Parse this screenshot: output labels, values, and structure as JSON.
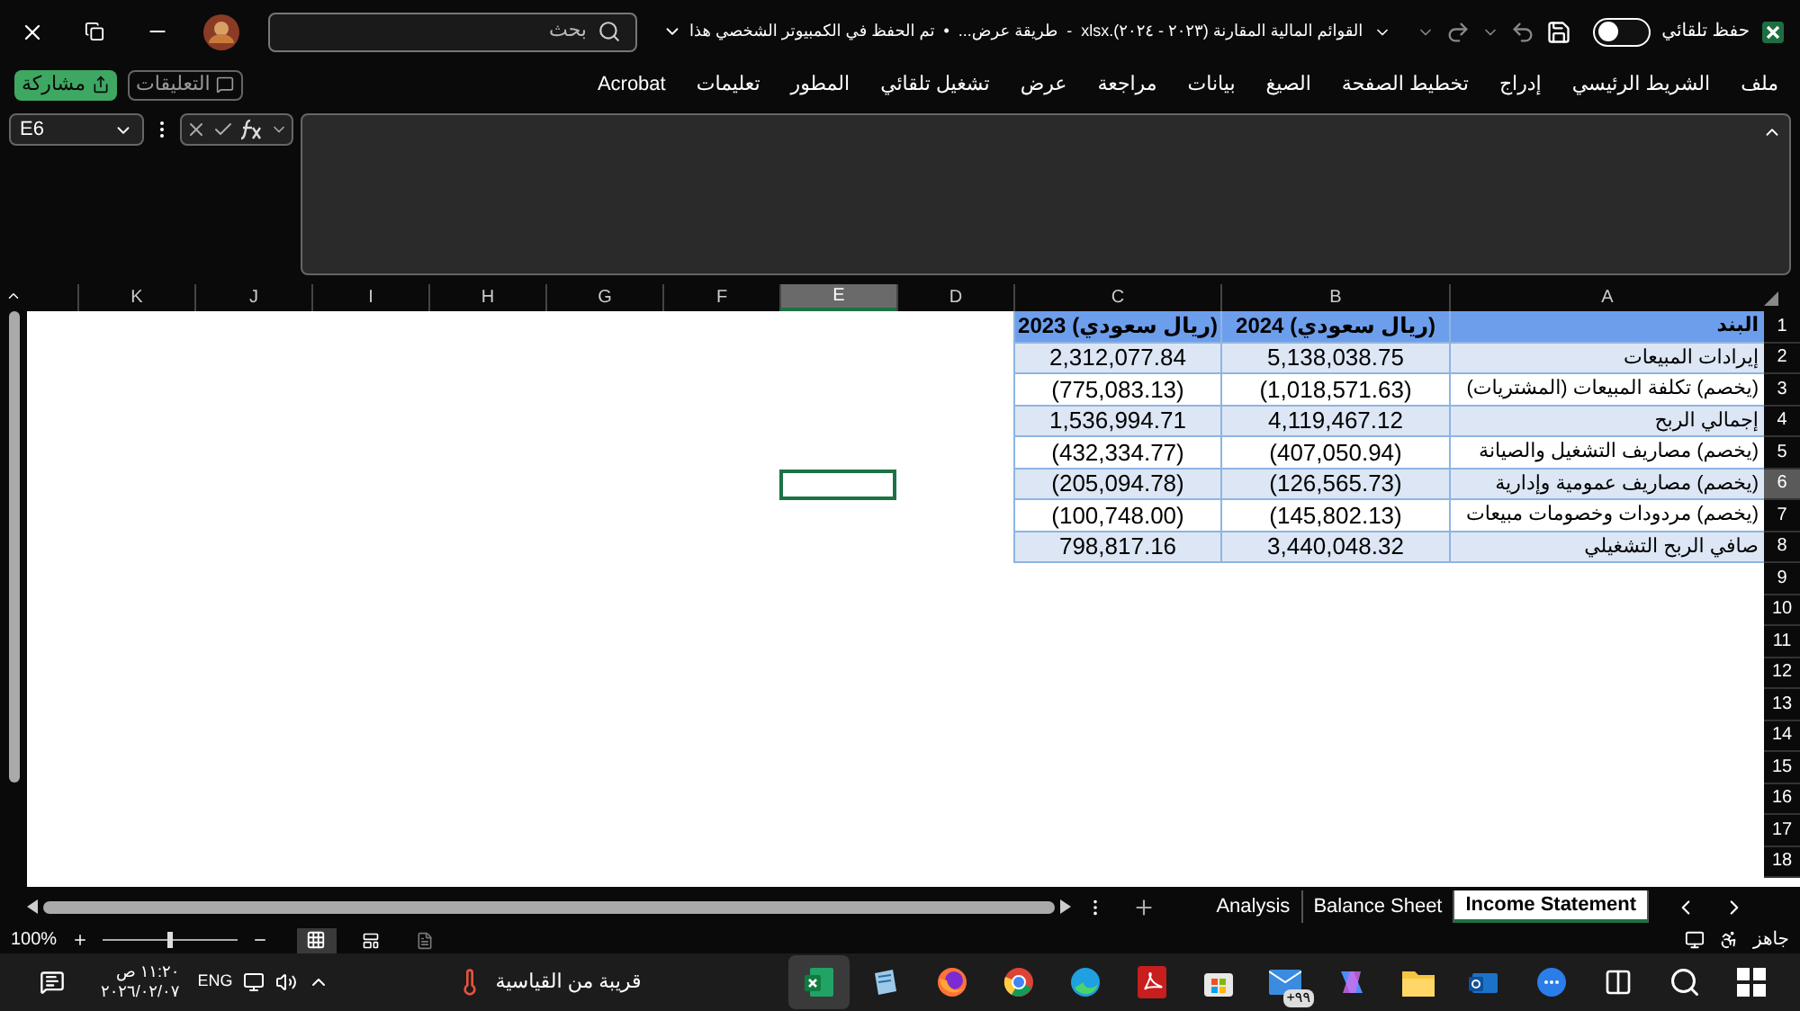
{
  "title_bar": {
    "autosave_label": "حفظ تلقائي",
    "autosave_on": false,
    "document_title": "القوائم المالية المقارنة (٢٠٢٣ - ٢٠٢٤).xlsx  -  طريقة عرض...  •  تم الحفظ في الكمبيوتر الشخصي هذا",
    "search": {
      "placeholder": "بحث"
    }
  },
  "ribbon": {
    "tabs": [
      "ملف",
      "الشريط الرئيسي",
      "إدراج",
      "تخطيط الصفحة",
      "الصيغ",
      "بيانات",
      "مراجعة",
      "عرض",
      "تشغيل تلقائي",
      "المطور",
      "تعليمات",
      "Acrobat"
    ],
    "comments_button": "التعليقات",
    "share_button": "مشاركة"
  },
  "formula_bar": {
    "name_box": "E6"
  },
  "sheet": {
    "columns": [
      {
        "label": "A",
        "selected": false
      },
      {
        "label": "B",
        "selected": false
      },
      {
        "label": "C",
        "selected": false
      },
      {
        "label": "D",
        "selected": false
      },
      {
        "label": "E",
        "selected": true
      },
      {
        "label": "F",
        "selected": false
      },
      {
        "label": "G",
        "selected": false
      },
      {
        "label": "H",
        "selected": false
      },
      {
        "label": "I",
        "selected": false
      },
      {
        "label": "J",
        "selected": false
      },
      {
        "label": "K",
        "selected": false
      }
    ],
    "rows": [
      {
        "number": "1",
        "selected": false,
        "cells": [
          "البند",
          "(ريال سعودي) 2024",
          "(ريال سعودي) 2023"
        ]
      },
      {
        "number": "2",
        "selected": false,
        "cells": [
          "إيرادات المبيعات",
          "5,138,038.75",
          "2,312,077.84"
        ]
      },
      {
        "number": "3",
        "selected": false,
        "cells": [
          "(يخصم) تكلفة المبيعات (المشتريات)",
          "(1,018,571.63)",
          "(775,083.13)"
        ]
      },
      {
        "number": "4",
        "selected": false,
        "cells": [
          "إجمالي الربح",
          "4,119,467.12",
          "1,536,994.71"
        ]
      },
      {
        "number": "5",
        "selected": false,
        "cells": [
          "(يخصم) مصاريف التشغيل والصيانة",
          "(407,050.94)",
          "(432,334.77)"
        ]
      },
      {
        "number": "6",
        "selected": true,
        "cells": [
          "(يخصم) مصاريف عمومية وإدارية",
          "(126,565.73)",
          "(205,094.78)"
        ]
      },
      {
        "number": "7",
        "selected": false,
        "cells": [
          "(يخصم) مردودات وخصومات مبيعات",
          "(145,802.13)",
          "(100,748.00)"
        ]
      },
      {
        "number": "8",
        "selected": false,
        "cells": [
          "صافي الربح التشغيلي",
          "3,440,048.32",
          "798,817.16"
        ]
      },
      {
        "number": "9",
        "selected": false
      },
      {
        "number": "10",
        "selected": false
      },
      {
        "number": "11",
        "selected": false
      },
      {
        "number": "12",
        "selected": false
      },
      {
        "number": "13",
        "selected": false
      },
      {
        "number": "14",
        "selected": false
      },
      {
        "number": "15",
        "selected": false
      },
      {
        "number": "16",
        "selected": false
      },
      {
        "number": "17",
        "selected": false
      },
      {
        "number": "18",
        "selected": false
      }
    ]
  },
  "sheet_tabs": [
    {
      "label": "Income Statement",
      "selected": true
    },
    {
      "label": "Balance Sheet",
      "selected": false
    },
    {
      "label": "Analysis",
      "selected": false
    }
  ],
  "status_bar": {
    "status": "جاهز",
    "zoom": "100%",
    "zoom_slider": {
      "level": 0.5
    },
    "views": [
      {
        "selected": false
      },
      {
        "selected": false
      },
      {
        "selected": true
      }
    ]
  },
  "taskbar": {
    "badge": "٩٩+",
    "weather": "قريبة من القياسية",
    "language": "ENG",
    "time": "١١:٢٠ ص",
    "date": "٢٠٢٦/٠٢/٠٧"
  }
}
